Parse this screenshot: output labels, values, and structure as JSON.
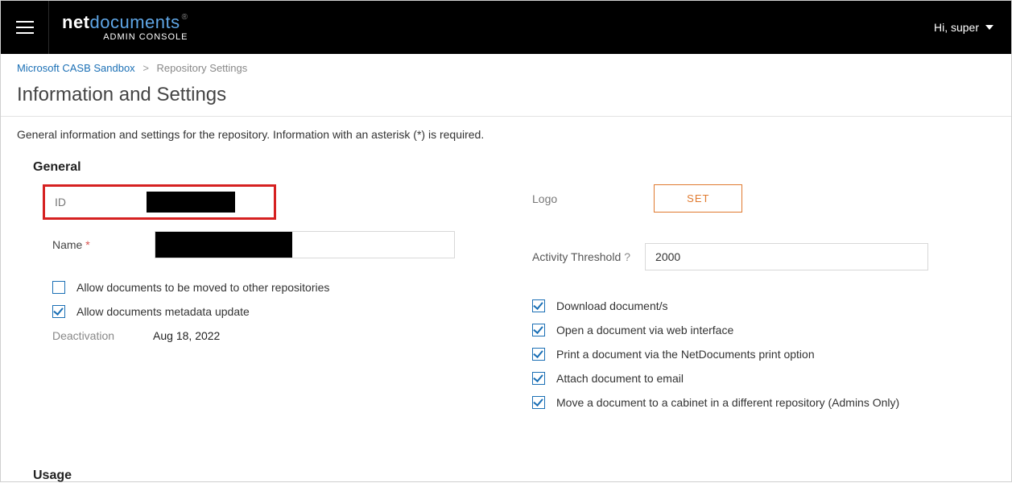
{
  "header": {
    "logo_part1": "net",
    "logo_part2": "documents",
    "logo_sub": "ADMIN CONSOLE",
    "user_greeting": "Hi, super"
  },
  "breadcrumb": {
    "root": "Microsoft CASB Sandbox",
    "current": "Repository Settings"
  },
  "page": {
    "title": "Information and Settings",
    "description": "General information and settings for the repository. Information with an asterisk (*) is required."
  },
  "sections": {
    "general": {
      "title": "General",
      "id_label": "ID",
      "name_label": "Name",
      "required_mark": "*",
      "allow_move_label": "Allow documents to be moved to other repositories",
      "allow_move_checked": false,
      "allow_meta_label": "Allow documents metadata update",
      "allow_meta_checked": true,
      "deactivation_label": "Deactivation",
      "deactivation_date": "Aug 18, 2022",
      "logo_label": "Logo",
      "set_button": "SET",
      "threshold_label": "Activity Threshold",
      "threshold_help": "?",
      "threshold_value": "2000",
      "permissions": [
        {
          "label": "Download document/s",
          "checked": true
        },
        {
          "label": "Open a document via web interface",
          "checked": true
        },
        {
          "label": "Print a document via the NetDocuments print option",
          "checked": true
        },
        {
          "label": "Attach document to email",
          "checked": true
        },
        {
          "label": "Move a document to a cabinet in a different repository (Admins Only)",
          "checked": true
        }
      ]
    },
    "usage": {
      "title": "Usage"
    }
  }
}
